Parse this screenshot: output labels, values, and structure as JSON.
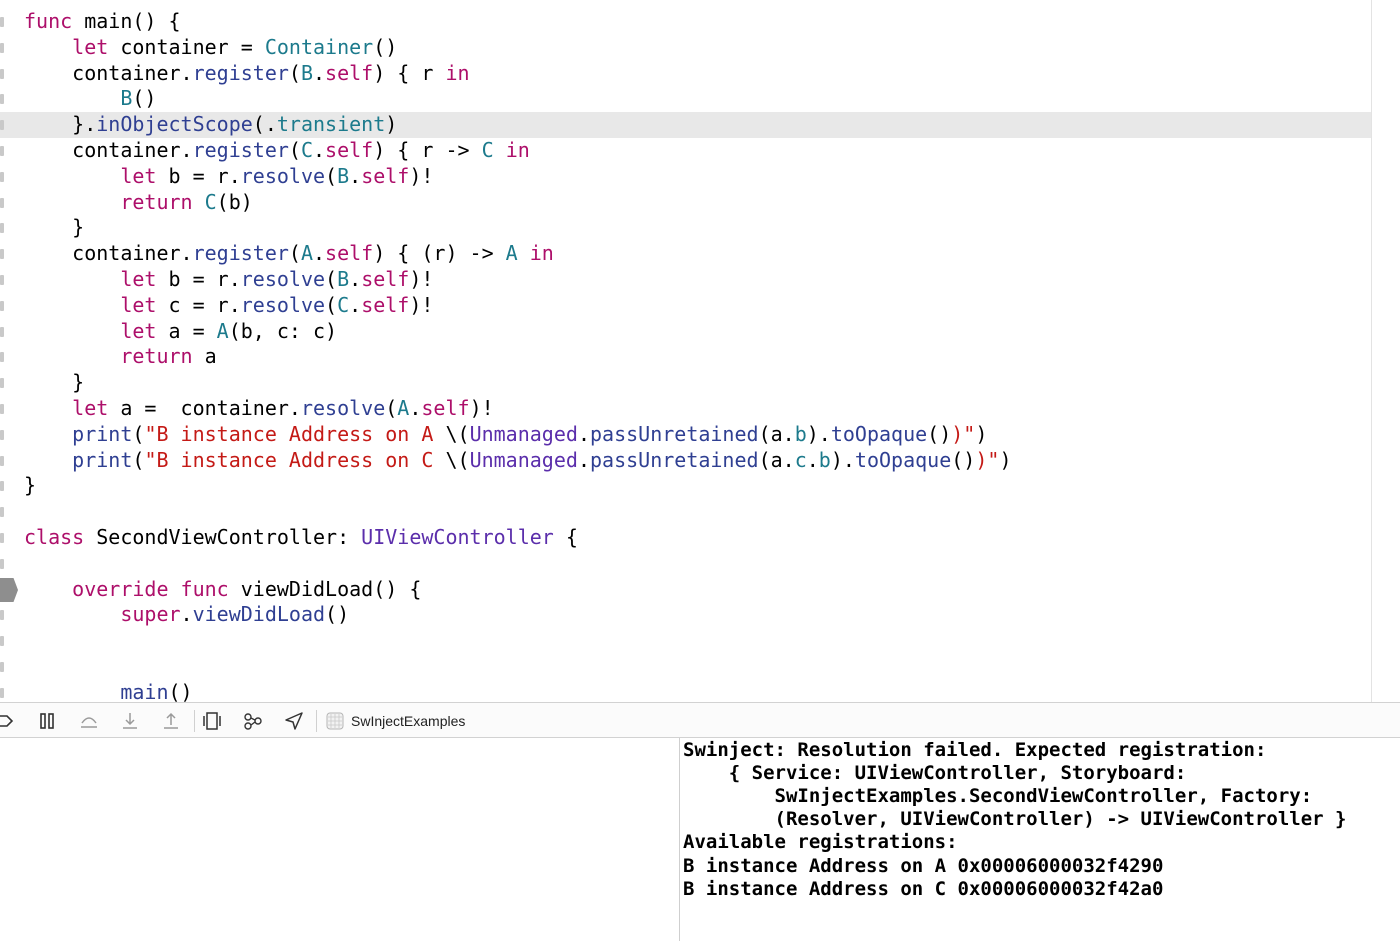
{
  "editor": {
    "highlighted_line": 4,
    "lines": [
      {
        "tokens": [
          [
            "kw",
            "func"
          ],
          [
            "pl",
            " main() {"
          ]
        ]
      },
      {
        "tokens": [
          [
            "pl",
            "    "
          ],
          [
            "kw",
            "let"
          ],
          [
            "pl",
            " container = "
          ],
          [
            "ty",
            "Container"
          ],
          [
            "pl",
            "()"
          ]
        ]
      },
      {
        "tokens": [
          [
            "pl",
            "    container."
          ],
          [
            "fn",
            "register"
          ],
          [
            "pl",
            "("
          ],
          [
            "ty",
            "B"
          ],
          [
            "pl",
            "."
          ],
          [
            "kw",
            "self"
          ],
          [
            "pl",
            ") { r "
          ],
          [
            "kw",
            "in"
          ]
        ]
      },
      {
        "tokens": [
          [
            "pl",
            "        "
          ],
          [
            "ty",
            "B"
          ],
          [
            "pl",
            "()"
          ]
        ]
      },
      {
        "tokens": [
          [
            "pl",
            "    }."
          ],
          [
            "fn",
            "inObjectScope"
          ],
          [
            "pl",
            "(."
          ],
          [
            "ty",
            "transient"
          ],
          [
            "pl",
            ")"
          ]
        ]
      },
      {
        "tokens": [
          [
            "pl",
            "    container."
          ],
          [
            "fn",
            "register"
          ],
          [
            "pl",
            "("
          ],
          [
            "ty",
            "C"
          ],
          [
            "pl",
            "."
          ],
          [
            "kw",
            "self"
          ],
          [
            "pl",
            ") { r -> "
          ],
          [
            "ty",
            "C"
          ],
          [
            "pl",
            " "
          ],
          [
            "kw",
            "in"
          ]
        ]
      },
      {
        "tokens": [
          [
            "pl",
            "        "
          ],
          [
            "kw",
            "let"
          ],
          [
            "pl",
            " b = r."
          ],
          [
            "fn",
            "resolve"
          ],
          [
            "pl",
            "("
          ],
          [
            "ty",
            "B"
          ],
          [
            "pl",
            "."
          ],
          [
            "kw",
            "self"
          ],
          [
            "pl",
            ")!"
          ]
        ]
      },
      {
        "tokens": [
          [
            "pl",
            "        "
          ],
          [
            "kw",
            "return"
          ],
          [
            "pl",
            " "
          ],
          [
            "ty",
            "C"
          ],
          [
            "pl",
            "(b)"
          ]
        ]
      },
      {
        "tokens": [
          [
            "pl",
            "    }"
          ]
        ]
      },
      {
        "tokens": [
          [
            "pl",
            "    container."
          ],
          [
            "fn",
            "register"
          ],
          [
            "pl",
            "("
          ],
          [
            "ty",
            "A"
          ],
          [
            "pl",
            "."
          ],
          [
            "kw",
            "self"
          ],
          [
            "pl",
            ") { (r) -> "
          ],
          [
            "ty",
            "A"
          ],
          [
            "pl",
            " "
          ],
          [
            "kw",
            "in"
          ]
        ]
      },
      {
        "tokens": [
          [
            "pl",
            "        "
          ],
          [
            "kw",
            "let"
          ],
          [
            "pl",
            " b = r."
          ],
          [
            "fn",
            "resolve"
          ],
          [
            "pl",
            "("
          ],
          [
            "ty",
            "B"
          ],
          [
            "pl",
            "."
          ],
          [
            "kw",
            "self"
          ],
          [
            "pl",
            ")!"
          ]
        ]
      },
      {
        "tokens": [
          [
            "pl",
            "        "
          ],
          [
            "kw",
            "let"
          ],
          [
            "pl",
            " c = r."
          ],
          [
            "fn",
            "resolve"
          ],
          [
            "pl",
            "("
          ],
          [
            "ty",
            "C"
          ],
          [
            "pl",
            "."
          ],
          [
            "kw",
            "self"
          ],
          [
            "pl",
            ")!"
          ]
        ]
      },
      {
        "tokens": [
          [
            "pl",
            "        "
          ],
          [
            "kw",
            "let"
          ],
          [
            "pl",
            " a = "
          ],
          [
            "ty",
            "A"
          ],
          [
            "pl",
            "(b, c: c)"
          ]
        ]
      },
      {
        "tokens": [
          [
            "pl",
            "        "
          ],
          [
            "kw",
            "return"
          ],
          [
            "pl",
            " a"
          ]
        ]
      },
      {
        "tokens": [
          [
            "pl",
            "    }"
          ]
        ]
      },
      {
        "tokens": [
          [
            "pl",
            "    "
          ],
          [
            "kw",
            "let"
          ],
          [
            "pl",
            " a =  container."
          ],
          [
            "fn",
            "resolve"
          ],
          [
            "pl",
            "("
          ],
          [
            "ty",
            "A"
          ],
          [
            "pl",
            "."
          ],
          [
            "kw",
            "self"
          ],
          [
            "pl",
            ")!"
          ]
        ]
      },
      {
        "tokens": [
          [
            "pl",
            "    "
          ],
          [
            "fn",
            "print"
          ],
          [
            "pl",
            "("
          ],
          [
            "str",
            "\"B instance Address on A "
          ],
          [
            "pl",
            "\\("
          ],
          [
            "lib",
            "Unmanaged"
          ],
          [
            "pl",
            "."
          ],
          [
            "fn",
            "passUnretained"
          ],
          [
            "pl",
            "(a."
          ],
          [
            "ty",
            "b"
          ],
          [
            "pl",
            ")."
          ],
          [
            "fn",
            "toOpaque"
          ],
          [
            "pl",
            "()"
          ],
          [
            "str",
            ")\""
          ],
          [
            "pl",
            ")"
          ]
        ]
      },
      {
        "tokens": [
          [
            "pl",
            "    "
          ],
          [
            "fn",
            "print"
          ],
          [
            "pl",
            "("
          ],
          [
            "str",
            "\"B instance Address on C "
          ],
          [
            "pl",
            "\\("
          ],
          [
            "lib",
            "Unmanaged"
          ],
          [
            "pl",
            "."
          ],
          [
            "fn",
            "passUnretained"
          ],
          [
            "pl",
            "(a."
          ],
          [
            "ty",
            "c"
          ],
          [
            "pl",
            "."
          ],
          [
            "ty",
            "b"
          ],
          [
            "pl",
            ")."
          ],
          [
            "fn",
            "toOpaque"
          ],
          [
            "pl",
            "()"
          ],
          [
            "str",
            ")\""
          ],
          [
            "pl",
            ")"
          ]
        ]
      },
      {
        "tokens": [
          [
            "pl",
            "}"
          ]
        ]
      },
      {
        "tokens": []
      },
      {
        "tokens": [
          [
            "kw",
            "class"
          ],
          [
            "pl",
            " SecondViewController: "
          ],
          [
            "lib",
            "UIViewController"
          ],
          [
            "pl",
            " {"
          ]
        ]
      },
      {
        "tokens": []
      },
      {
        "tokens": [
          [
            "pl",
            "    "
          ],
          [
            "kw",
            "override"
          ],
          [
            "pl",
            " "
          ],
          [
            "kw",
            "func"
          ],
          [
            "pl",
            " viewDidLoad() {"
          ]
        ]
      },
      {
        "tokens": [
          [
            "pl",
            "        "
          ],
          [
            "kw",
            "super"
          ],
          [
            "pl",
            "."
          ],
          [
            "fn",
            "viewDidLoad"
          ],
          [
            "pl",
            "()"
          ]
        ]
      },
      {
        "tokens": []
      },
      {
        "tokens": []
      },
      {
        "tokens": [
          [
            "pl",
            "        "
          ],
          [
            "fn",
            "main"
          ],
          [
            "pl",
            "()"
          ]
        ]
      }
    ]
  },
  "toolbar": {
    "buttons": [
      "breakpoints-toggle-icon",
      "pause-icon",
      "step-over-icon",
      "step-into-icon",
      "step-out-icon",
      "view-hierarchy-icon",
      "memory-graph-icon",
      "location-icon"
    ],
    "scheme_label": "SwInjectExamples"
  },
  "console": {
    "lines": [
      "Swinject: Resolution failed. Expected registration:",
      "    { Service: UIViewController, Storyboard:",
      "        SwInjectExamples.SecondViewController, Factory:",
      "        (Resolver, UIViewController) -> UIViewController }",
      "Available registrations:",
      "B instance Address on A 0x00006000032f4290",
      "B instance Address on C 0x00006000032f42a0"
    ]
  }
}
